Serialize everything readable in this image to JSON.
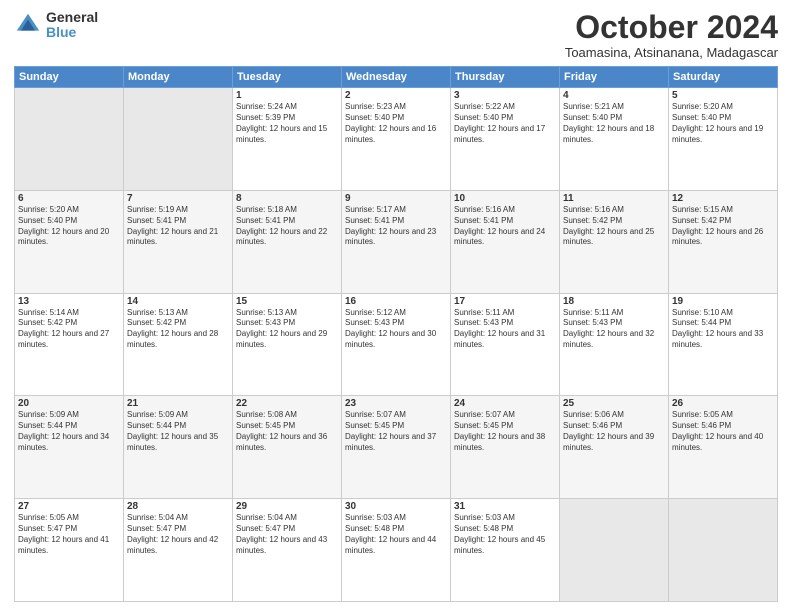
{
  "logo": {
    "general": "General",
    "blue": "Blue"
  },
  "header": {
    "month": "October 2024",
    "location": "Toamasina, Atsinanana, Madagascar"
  },
  "weekdays": [
    "Sunday",
    "Monday",
    "Tuesday",
    "Wednesday",
    "Thursday",
    "Friday",
    "Saturday"
  ],
  "weeks": [
    [
      {
        "day": "",
        "info": ""
      },
      {
        "day": "",
        "info": ""
      },
      {
        "day": "1",
        "info": "Sunrise: 5:24 AM\nSunset: 5:39 PM\nDaylight: 12 hours and 15 minutes."
      },
      {
        "day": "2",
        "info": "Sunrise: 5:23 AM\nSunset: 5:40 PM\nDaylight: 12 hours and 16 minutes."
      },
      {
        "day": "3",
        "info": "Sunrise: 5:22 AM\nSunset: 5:40 PM\nDaylight: 12 hours and 17 minutes."
      },
      {
        "day": "4",
        "info": "Sunrise: 5:21 AM\nSunset: 5:40 PM\nDaylight: 12 hours and 18 minutes."
      },
      {
        "day": "5",
        "info": "Sunrise: 5:20 AM\nSunset: 5:40 PM\nDaylight: 12 hours and 19 minutes."
      }
    ],
    [
      {
        "day": "6",
        "info": "Sunrise: 5:20 AM\nSunset: 5:40 PM\nDaylight: 12 hours and 20 minutes."
      },
      {
        "day": "7",
        "info": "Sunrise: 5:19 AM\nSunset: 5:41 PM\nDaylight: 12 hours and 21 minutes."
      },
      {
        "day": "8",
        "info": "Sunrise: 5:18 AM\nSunset: 5:41 PM\nDaylight: 12 hours and 22 minutes."
      },
      {
        "day": "9",
        "info": "Sunrise: 5:17 AM\nSunset: 5:41 PM\nDaylight: 12 hours and 23 minutes."
      },
      {
        "day": "10",
        "info": "Sunrise: 5:16 AM\nSunset: 5:41 PM\nDaylight: 12 hours and 24 minutes."
      },
      {
        "day": "11",
        "info": "Sunrise: 5:16 AM\nSunset: 5:42 PM\nDaylight: 12 hours and 25 minutes."
      },
      {
        "day": "12",
        "info": "Sunrise: 5:15 AM\nSunset: 5:42 PM\nDaylight: 12 hours and 26 minutes."
      }
    ],
    [
      {
        "day": "13",
        "info": "Sunrise: 5:14 AM\nSunset: 5:42 PM\nDaylight: 12 hours and 27 minutes."
      },
      {
        "day": "14",
        "info": "Sunrise: 5:13 AM\nSunset: 5:42 PM\nDaylight: 12 hours and 28 minutes."
      },
      {
        "day": "15",
        "info": "Sunrise: 5:13 AM\nSunset: 5:43 PM\nDaylight: 12 hours and 29 minutes."
      },
      {
        "day": "16",
        "info": "Sunrise: 5:12 AM\nSunset: 5:43 PM\nDaylight: 12 hours and 30 minutes."
      },
      {
        "day": "17",
        "info": "Sunrise: 5:11 AM\nSunset: 5:43 PM\nDaylight: 12 hours and 31 minutes."
      },
      {
        "day": "18",
        "info": "Sunrise: 5:11 AM\nSunset: 5:43 PM\nDaylight: 12 hours and 32 minutes."
      },
      {
        "day": "19",
        "info": "Sunrise: 5:10 AM\nSunset: 5:44 PM\nDaylight: 12 hours and 33 minutes."
      }
    ],
    [
      {
        "day": "20",
        "info": "Sunrise: 5:09 AM\nSunset: 5:44 PM\nDaylight: 12 hours and 34 minutes."
      },
      {
        "day": "21",
        "info": "Sunrise: 5:09 AM\nSunset: 5:44 PM\nDaylight: 12 hours and 35 minutes."
      },
      {
        "day": "22",
        "info": "Sunrise: 5:08 AM\nSunset: 5:45 PM\nDaylight: 12 hours and 36 minutes."
      },
      {
        "day": "23",
        "info": "Sunrise: 5:07 AM\nSunset: 5:45 PM\nDaylight: 12 hours and 37 minutes."
      },
      {
        "day": "24",
        "info": "Sunrise: 5:07 AM\nSunset: 5:45 PM\nDaylight: 12 hours and 38 minutes."
      },
      {
        "day": "25",
        "info": "Sunrise: 5:06 AM\nSunset: 5:46 PM\nDaylight: 12 hours and 39 minutes."
      },
      {
        "day": "26",
        "info": "Sunrise: 5:05 AM\nSunset: 5:46 PM\nDaylight: 12 hours and 40 minutes."
      }
    ],
    [
      {
        "day": "27",
        "info": "Sunrise: 5:05 AM\nSunset: 5:47 PM\nDaylight: 12 hours and 41 minutes."
      },
      {
        "day": "28",
        "info": "Sunrise: 5:04 AM\nSunset: 5:47 PM\nDaylight: 12 hours and 42 minutes."
      },
      {
        "day": "29",
        "info": "Sunrise: 5:04 AM\nSunset: 5:47 PM\nDaylight: 12 hours and 43 minutes."
      },
      {
        "day": "30",
        "info": "Sunrise: 5:03 AM\nSunset: 5:48 PM\nDaylight: 12 hours and 44 minutes."
      },
      {
        "day": "31",
        "info": "Sunrise: 5:03 AM\nSunset: 5:48 PM\nDaylight: 12 hours and 45 minutes."
      },
      {
        "day": "",
        "info": ""
      },
      {
        "day": "",
        "info": ""
      }
    ]
  ]
}
